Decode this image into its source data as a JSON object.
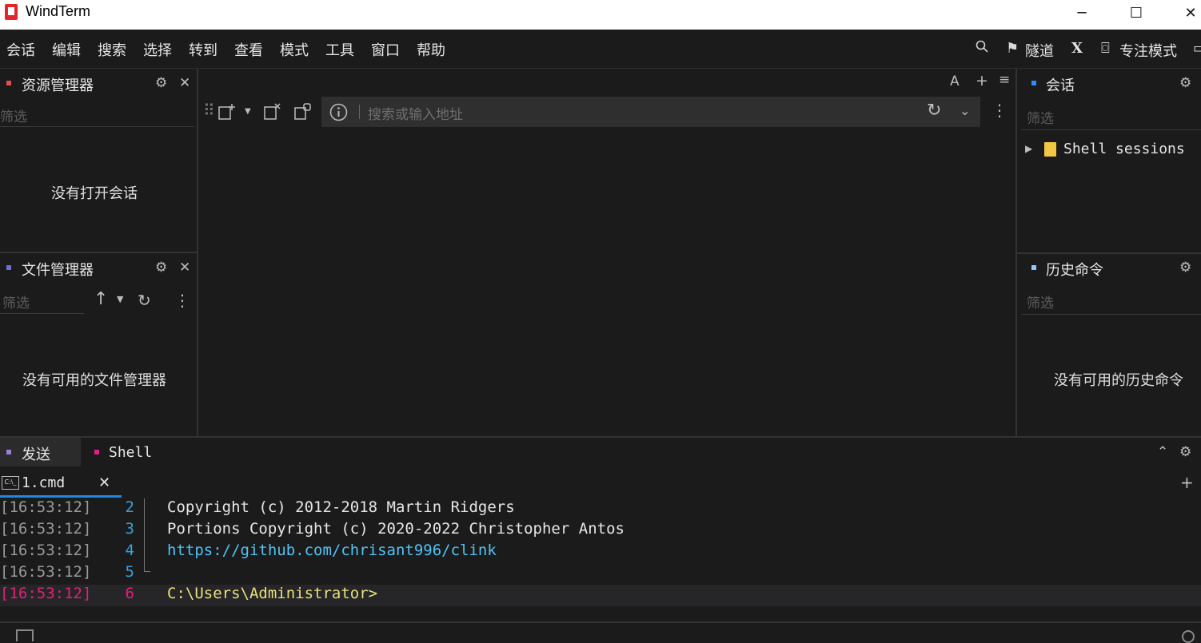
{
  "window": {
    "title": "WindTerm"
  },
  "menu": [
    "会话",
    "编辑",
    "搜索",
    "选择",
    "转到",
    "查看",
    "模式",
    "工具",
    "窗口",
    "帮助"
  ],
  "toolbar": {
    "tunnel_label": "隧道",
    "x_label": "X",
    "focus_label": "专注模式"
  },
  "resource_manager": {
    "title": "资源管理器",
    "filter_placeholder": "筛选",
    "empty": "没有打开会话"
  },
  "file_manager": {
    "title": "文件管理器",
    "filter_placeholder": "筛选",
    "empty": "没有可用的文件管理器"
  },
  "center": {
    "font_btn": "A",
    "add_btn": "+",
    "menu_btn": "≡",
    "address_placeholder": "搜索或输入地址"
  },
  "sessions": {
    "title": "会话",
    "filter_placeholder": "筛选",
    "tree": [
      {
        "label": "Shell sessions"
      }
    ]
  },
  "history": {
    "title": "历史命令",
    "filter_placeholder": "筛选",
    "empty": "没有可用的历史命令"
  },
  "bottom": {
    "tabs": [
      {
        "label": "发送",
        "color": "#9a7fd8"
      },
      {
        "label": "Shell",
        "color": "#e0208a"
      }
    ],
    "file_tab": {
      "label": "1.cmd"
    },
    "lines": [
      {
        "time": "[16:53:12]",
        "num": "2",
        "text": "Copyright (c) 2012-2018 Martin Ridgers"
      },
      {
        "time": "[16:53:12]",
        "num": "3",
        "text": "Portions Copyright (c) 2020-2022 Christopher Antos"
      },
      {
        "time": "[16:53:12]",
        "num": "4",
        "text": "https://github.com/chrisant996/clink"
      },
      {
        "time": "[16:53:12]",
        "num": "5",
        "text": ""
      },
      {
        "time": "[16:53:12]",
        "num": "6",
        "text": "C:\\Users\\Administrator>"
      }
    ]
  },
  "colors": {
    "accent_blue": "#1e88e5",
    "resource_square": "#e05050",
    "file_square": "#6e6ed8",
    "session_square": "#2f8cff",
    "history_square": "#8ec8ff",
    "active_time": "#e0207a",
    "path": "#e8e07a",
    "link": "#4fc3f7"
  }
}
